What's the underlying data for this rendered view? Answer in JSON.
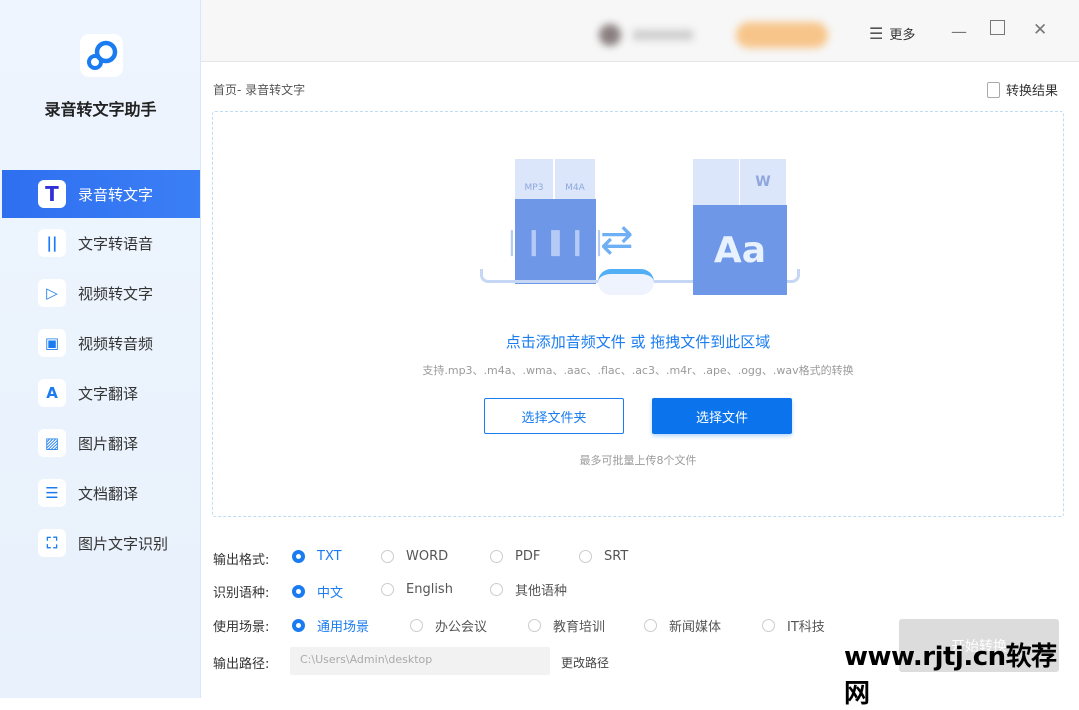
{
  "sidebar": {
    "app_title": "录音转文字助手",
    "items": [
      {
        "label": "录音转文字",
        "icon": "T"
      },
      {
        "label": "文字转语音",
        "icon": "||"
      },
      {
        "label": "视频转文字",
        "icon": "▷"
      },
      {
        "label": "视频转音频",
        "icon": "▣"
      },
      {
        "label": "文字翻译",
        "icon": "A"
      },
      {
        "label": "图片翻译",
        "icon": "▨"
      },
      {
        "label": "文档翻译",
        "icon": "☰"
      },
      {
        "label": "图片文字识别",
        "icon": "⛶"
      }
    ]
  },
  "header": {
    "more": "更多",
    "minimize": "—",
    "maximize": "☐",
    "close": "✕"
  },
  "breadcrumb": "首页- 录音转文字",
  "result_link": "转换结果",
  "drop": {
    "main": "点击添加音频文件 或 拖拽文件到此区域",
    "support": "支持.mp3、.m4a、.wma、.aac、.flac、.ac3、.m4r、.ape、.ogg、.wav格式的转换",
    "folder_button": "选择文件夹",
    "file_button": "选择文件",
    "hint": "最多可批量上传8个文件",
    "tags": {
      "mp3": "MP3",
      "m4a": "M4A",
      "aa": "Aa",
      "w": "W"
    }
  },
  "options": {
    "format": {
      "label": "输出格式:",
      "choices": [
        "TXT",
        "WORD",
        "PDF",
        "SRT"
      ],
      "selected": 0
    },
    "language": {
      "label": "识别语种:",
      "choices": [
        "中文",
        "English",
        "其他语种"
      ],
      "selected": 0
    },
    "scene": {
      "label": "使用场景:",
      "choices": [
        "通用场景",
        "办公会议",
        "教育培训",
        "新闻媒体",
        "IT科技"
      ],
      "selected": 0
    },
    "path": {
      "label": "输出路径:",
      "value": "C:\\Users\\Admin\\desktop",
      "change": "更改路径"
    }
  },
  "start_button": "开始转换",
  "watermark": "www.rjtj.cn软荐网"
}
